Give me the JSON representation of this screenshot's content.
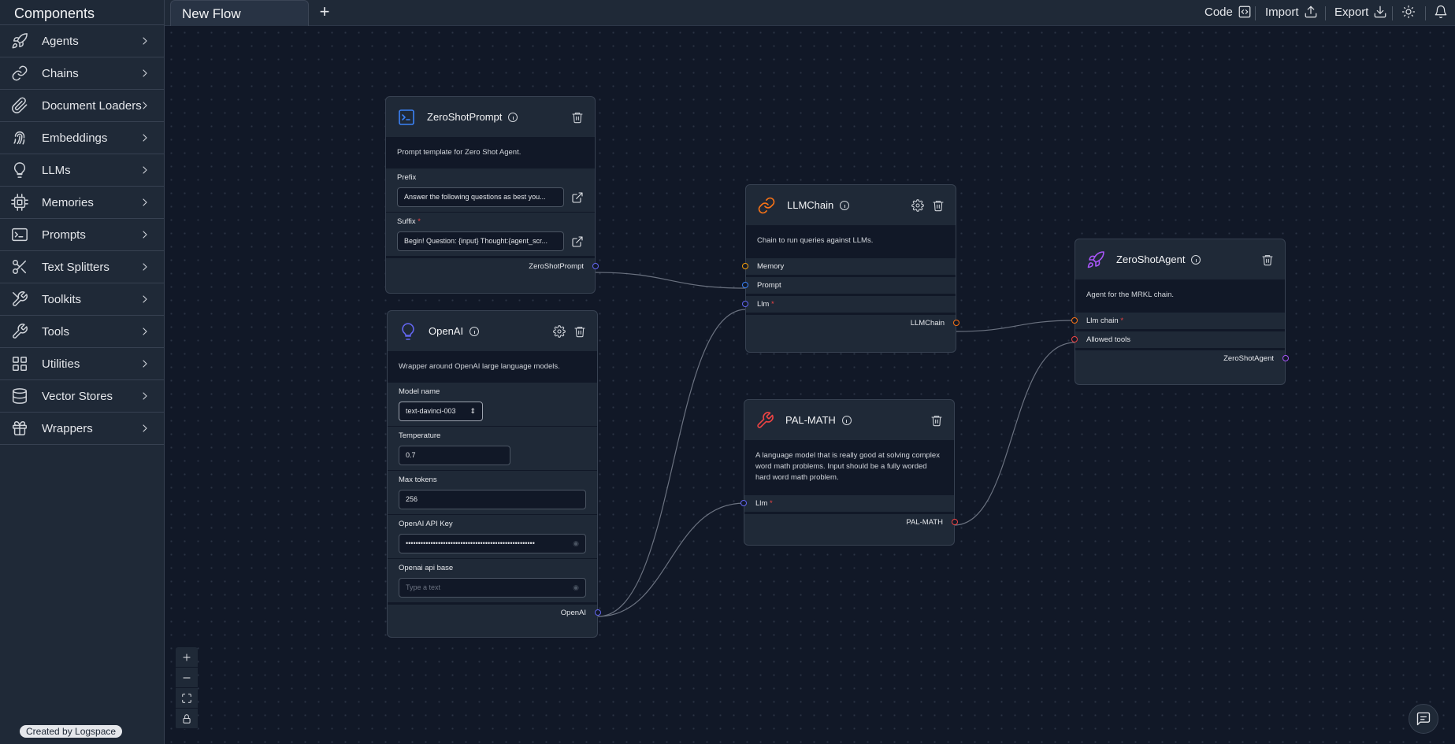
{
  "sidebar": {
    "title": "Components",
    "categories": [
      {
        "label": "Agents",
        "icon": "rocket-icon"
      },
      {
        "label": "Chains",
        "icon": "link-icon"
      },
      {
        "label": "Document Loaders",
        "icon": "paperclip-icon"
      },
      {
        "label": "Embeddings",
        "icon": "fingerprint-icon"
      },
      {
        "label": "LLMs",
        "icon": "lightbulb-icon"
      },
      {
        "label": "Memories",
        "icon": "cpu-icon"
      },
      {
        "label": "Prompts",
        "icon": "terminal-icon"
      },
      {
        "label": "Text Splitters",
        "icon": "scissors-icon"
      },
      {
        "label": "Toolkits",
        "icon": "tools-icon"
      },
      {
        "label": "Tools",
        "icon": "wrench-icon"
      },
      {
        "label": "Utilities",
        "icon": "grid-icon"
      },
      {
        "label": "Vector Stores",
        "icon": "database-icon"
      },
      {
        "label": "Wrappers",
        "icon": "gift-icon"
      }
    ],
    "credit": "Created by Logspace"
  },
  "topbar": {
    "tab_name": "New Flow",
    "add_tab": "+",
    "code_label": "Code",
    "import_label": "Import",
    "export_label": "Export"
  },
  "nodes": {
    "zeroshotprompt": {
      "title": "ZeroShotPrompt",
      "description": "Prompt template for Zero Shot Agent.",
      "prefix_label": "Prefix",
      "prefix_value": "Answer the following questions as best you...",
      "suffix_label": "Suffix",
      "suffix_value": "Begin! Question: {input} Thought:{agent_scr...",
      "output": "ZeroShotPrompt"
    },
    "openai": {
      "title": "OpenAI",
      "description": "Wrapper around OpenAI large language models.",
      "model_label": "Model name",
      "model_value": "text-davinci-003",
      "temperature_label": "Temperature",
      "temperature_value": "0.7",
      "maxtokens_label": "Max tokens",
      "maxtokens_value": "256",
      "apikey_label": "OpenAI API Key",
      "apikey_value": "••••••••••••••••••••••••••••••••••••••••••••••••••••",
      "apibase_label": "Openai api base",
      "apibase_placeholder": "Type a text",
      "output": "OpenAI"
    },
    "llmchain": {
      "title": "LLMChain",
      "description": "Chain to run queries against LLMs.",
      "memory_label": "Memory",
      "prompt_label": "Prompt",
      "llm_label": "Llm",
      "output": "LLMChain"
    },
    "palmath": {
      "title": "PAL-MATH",
      "description": "A language model that is really good at solving complex word math problems. Input should be a fully worded hard word math problem.",
      "llm_label": "Llm",
      "output": "PAL-MATH"
    },
    "zeroshotagent": {
      "title": "ZeroShotAgent",
      "description": "Agent for the MRKL chain.",
      "llmchain_label": "Llm chain",
      "tools_label": "Allowed tools",
      "output": "ZeroShotAgent"
    }
  },
  "required_mark": "*",
  "colors": {
    "prompt_accent": "#3b82f6",
    "llm_accent": "#6366f1",
    "chain_accent": "#f97316",
    "tool_accent": "#ef4444",
    "agent_accent": "#a855f7"
  }
}
